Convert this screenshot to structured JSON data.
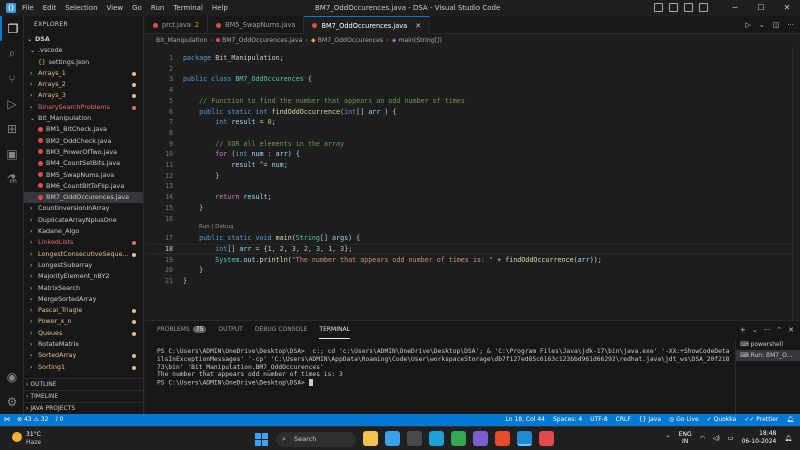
{
  "titlebar": {
    "menu": [
      "File",
      "Edit",
      "Selection",
      "View",
      "Go",
      "Run",
      "Terminal",
      "Help"
    ],
    "title": "BM7_OddOccurences.java - DSA - Visual Studio Code"
  },
  "sidebar": {
    "header": "EXPLORER",
    "root": "DSA",
    "rows": [
      {
        "label": ".vscode",
        "kind": "folder-open",
        "indent": 1,
        "color": "#cccccc"
      },
      {
        "label": "settings.json",
        "kind": "json",
        "indent": 2,
        "color": "#cccccc"
      },
      {
        "label": "Arrays_1",
        "kind": "folder",
        "indent": 1,
        "color": "#e2c08d",
        "dot": "#e2c08d"
      },
      {
        "label": "Arrays_2",
        "kind": "folder",
        "indent": 1,
        "color": "#e2c08d",
        "dot": "#e2c08d"
      },
      {
        "label": "Arrays_3",
        "kind": "folder",
        "indent": 1,
        "color": "#e2c08d",
        "dot": "#e2c08d"
      },
      {
        "label": "BinarySearchProblems",
        "kind": "folder",
        "indent": 1,
        "color": "#e06c6c",
        "dot": "#e06c6c"
      },
      {
        "label": "Bit_Manipulation",
        "kind": "folder-open",
        "indent": 1,
        "color": "#cccccc"
      },
      {
        "label": "BM1_BitCheck.java",
        "kind": "java",
        "indent": 2,
        "color": "#cccccc"
      },
      {
        "label": "BM2_OddCheck.java",
        "kind": "java",
        "indent": 2,
        "color": "#cccccc"
      },
      {
        "label": "BM3_PowerOfTwo.java",
        "kind": "java",
        "indent": 2,
        "color": "#cccccc"
      },
      {
        "label": "BM4_CountSetBits.java",
        "kind": "java",
        "indent": 2,
        "color": "#cccccc"
      },
      {
        "label": "BM5_SwapNums.java",
        "kind": "java",
        "indent": 2,
        "color": "#cccccc"
      },
      {
        "label": "BM6_CountBitToFlip.java",
        "kind": "java",
        "indent": 2,
        "color": "#cccccc"
      },
      {
        "label": "BM7_OddOccurences.java",
        "kind": "java",
        "indent": 2,
        "color": "#cccccc",
        "selected": true
      },
      {
        "label": "CountInversionInArray",
        "kind": "folder",
        "indent": 1,
        "color": "#cccccc"
      },
      {
        "label": "DuplicateArrayNplusOne",
        "kind": "folder",
        "indent": 1,
        "color": "#cccccc"
      },
      {
        "label": "Kadane_Algo",
        "kind": "folder",
        "indent": 1,
        "color": "#cccccc"
      },
      {
        "label": "LinkedLists",
        "kind": "folder",
        "indent": 1,
        "color": "#e06c6c",
        "dot": "#e06c6c"
      },
      {
        "label": "LongestConsecutiveSeque...",
        "kind": "folder",
        "indent": 1,
        "color": "#e2c08d",
        "dot": "#e2c08d"
      },
      {
        "label": "LongestSubarray",
        "kind": "folder",
        "indent": 1,
        "color": "#cccccc"
      },
      {
        "label": "MajorityElement_nBY2",
        "kind": "folder",
        "indent": 1,
        "color": "#cccccc"
      },
      {
        "label": "MatrixSearch",
        "kind": "folder",
        "indent": 1,
        "color": "#cccccc"
      },
      {
        "label": "MergeSortedArray",
        "kind": "folder",
        "indent": 1,
        "color": "#cccccc"
      },
      {
        "label": "Pascal_Triagle",
        "kind": "folder",
        "indent": 1,
        "color": "#e2c08d",
        "dot": "#e2c08d"
      },
      {
        "label": "Power_x_n",
        "kind": "folder",
        "indent": 1,
        "color": "#e2c08d",
        "dot": "#e2c08d"
      },
      {
        "label": "Queues",
        "kind": "folder",
        "indent": 1,
        "color": "#e2c08d",
        "dot": "#e2c08d"
      },
      {
        "label": "RotateMatrix",
        "kind": "folder",
        "indent": 1,
        "color": "#cccccc"
      },
      {
        "label": "SortedArray",
        "kind": "folder",
        "indent": 1,
        "color": "#e2c08d",
        "dot": "#e2c08d"
      },
      {
        "label": "Sorting1",
        "kind": "folder",
        "indent": 1,
        "color": "#e2c08d",
        "dot": "#e2c08d"
      }
    ],
    "sections": [
      "OUTLINE",
      "TIMELINE",
      "JAVA PROJECTS"
    ]
  },
  "tabs": [
    {
      "label": "prct.java",
      "badge": "2",
      "active": false
    },
    {
      "label": "BM5_SwapNums.java",
      "badge": "",
      "active": false
    },
    {
      "label": "BM7_OddOccurences.java",
      "badge": "",
      "active": true
    }
  ],
  "breadcrumb": [
    "Bit_Manipulation",
    "BM7_OddOccurences.java",
    "BM7_OddOccurences",
    "main(String[])"
  ],
  "editor": {
    "current_line": 18,
    "lines": [
      {
        "n": "1",
        "tokens": [
          [
            "kw",
            "package "
          ],
          [
            "",
            "Bit_Manipulation;"
          ]
        ]
      },
      {
        "n": "2",
        "tokens": []
      },
      {
        "n": "3",
        "tokens": [
          [
            "kw",
            "public class "
          ],
          [
            "ty",
            "BM7_OddOccurences"
          ],
          [
            "",
            " {"
          ]
        ]
      },
      {
        "n": "4",
        "tokens": []
      },
      {
        "n": "5",
        "tokens": [
          [
            "",
            "    "
          ],
          [
            "cm",
            "// Function to find the number that appears an odd number of times"
          ]
        ]
      },
      {
        "n": "6",
        "tokens": [
          [
            "",
            "    "
          ],
          [
            "kw",
            "public static int "
          ],
          [
            "fn",
            "findOddOccurrence"
          ],
          [
            "",
            "("
          ],
          [
            "kw",
            "int"
          ],
          [
            "",
            "[] "
          ],
          [
            "vr",
            "arr"
          ],
          [
            "",
            " ) {"
          ]
        ]
      },
      {
        "n": "7",
        "tokens": [
          [
            "",
            "        "
          ],
          [
            "kw",
            "int "
          ],
          [
            "vr",
            "result"
          ],
          [
            "",
            " = "
          ],
          [
            "nm",
            "0"
          ],
          [
            "",
            ";"
          ]
        ]
      },
      {
        "n": "8",
        "tokens": []
      },
      {
        "n": "9",
        "tokens": [
          [
            "",
            "        "
          ],
          [
            "cm",
            "// XOR all elements in the array"
          ]
        ]
      },
      {
        "n": "10",
        "tokens": [
          [
            "",
            "        "
          ],
          [
            "ctl",
            "for"
          ],
          [
            "",
            " ("
          ],
          [
            "kw",
            "int "
          ],
          [
            "vr",
            "num"
          ],
          [
            "",
            " : "
          ],
          [
            "vr",
            "arr"
          ],
          [
            "",
            ") {"
          ]
        ]
      },
      {
        "n": "11",
        "tokens": [
          [
            "",
            "            "
          ],
          [
            "vr",
            "result"
          ],
          [
            "",
            " ^= "
          ],
          [
            "vr",
            "num"
          ],
          [
            "",
            ";"
          ]
        ]
      },
      {
        "n": "12",
        "tokens": [
          [
            "",
            "        }"
          ]
        ]
      },
      {
        "n": "13",
        "tokens": []
      },
      {
        "n": "14",
        "tokens": [
          [
            "",
            "        "
          ],
          [
            "ctl",
            "return "
          ],
          [
            "vr",
            "result"
          ],
          [
            "",
            ";"
          ]
        ]
      },
      {
        "n": "15",
        "tokens": [
          [
            "",
            "    }"
          ]
        ]
      },
      {
        "n": "16",
        "tokens": []
      },
      {
        "n": "17",
        "tokens": [
          [
            "",
            "    "
          ],
          [
            "kw",
            "public static void "
          ],
          [
            "fn",
            "main"
          ],
          [
            "",
            "("
          ],
          [
            "ty",
            "String"
          ],
          [
            "",
            "[] "
          ],
          [
            "vr",
            "args"
          ],
          [
            "",
            ") {"
          ]
        ]
      },
      {
        "n": "18",
        "tokens": [
          [
            "",
            "        "
          ],
          [
            "kw",
            "int"
          ],
          [
            "",
            "[] "
          ],
          [
            "vr",
            "arr"
          ],
          [
            "",
            " = {"
          ],
          [
            "nm",
            "1"
          ],
          [
            "",
            ", "
          ],
          [
            "nm",
            "2"
          ],
          [
            "",
            ", "
          ],
          [
            "nm",
            "3"
          ],
          [
            "",
            ", "
          ],
          [
            "nm",
            "2"
          ],
          [
            "",
            ", "
          ],
          [
            "nm",
            "3"
          ],
          [
            "",
            ", "
          ],
          [
            "nm",
            "1"
          ],
          [
            "",
            ", "
          ],
          [
            "nm",
            "3"
          ],
          [
            "",
            "};"
          ]
        ]
      },
      {
        "n": "19",
        "tokens": [
          [
            "",
            "        "
          ],
          [
            "ty",
            "System"
          ],
          [
            "",
            "."
          ],
          [
            "vr",
            "out"
          ],
          [
            "",
            "."
          ],
          [
            "fn",
            "println"
          ],
          [
            "",
            "("
          ],
          [
            "str",
            "\"The number that appears odd number of times is: \""
          ],
          [
            "",
            " + "
          ],
          [
            "fn",
            "findOddOccurrence"
          ],
          [
            "",
            "("
          ],
          [
            "vr",
            "arr"
          ],
          [
            "",
            "));"
          ]
        ]
      },
      {
        "n": "20",
        "tokens": [
          [
            "",
            "    }"
          ]
        ]
      },
      {
        "n": "21",
        "tokens": [
          [
            "",
            "}"
          ]
        ]
      }
    ],
    "codelens": "Run | Debug"
  },
  "panel": {
    "tabs": [
      {
        "label": "PROBLEMS",
        "count": "75"
      },
      {
        "label": "OUTPUT",
        "count": ""
      },
      {
        "label": "DEBUG CONSOLE",
        "count": ""
      },
      {
        "label": "TERMINAL",
        "count": "",
        "active": true
      }
    ],
    "terminal_lines": [
      "PS C:\\Users\\ADMIN\\OneDrive\\Desktop\\DSA>  c:; cd 'c:\\Users\\ADMIN\\OneDrive\\Desktop\\DSA'; & 'C:\\Program Files\\Java\\jdk-17\\bin\\java.exe' '-XX:+ShowCodeDeta",
      "ilsInExceptionMessages' '-cp' 'C:\\Users\\ADMIN\\AppData\\Roaming\\Code\\User\\workspaceStorage\\db7f127ed85c6163c123bbd961d66292\\redhat.java\\jdt_ws\\DSA_20f218",
      "73\\bin' 'Bit_Manipulation.BM7_OddOccurences'",
      "The number that appears odd number of times is: 3",
      "PS C:\\Users\\ADMIN\\OneDrive\\Desktop\\DSA> "
    ],
    "terminals": [
      "powershell",
      "Run: BM7_O..."
    ]
  },
  "statusbar": {
    "errors": "43",
    "warnings": "32",
    "position": "Ln 18, Col 44",
    "spaces": "Spaces: 4",
    "encoding": "UTF-8",
    "eol": "CRLF",
    "language": "Java",
    "golive": "Go Live",
    "quokka": "Quokka",
    "prettier": "Prettier"
  },
  "taskbar": {
    "weather_temp": "31°C",
    "weather_desc": "Haze",
    "search_placeholder": "Search",
    "lang_top": "ENG",
    "lang_bottom": "IN",
    "time": "18:48",
    "date": "06-10-2024",
    "apps": [
      {
        "name": "file-explorer-app-icon",
        "color": "#f2c14e"
      },
      {
        "name": "photos-app-icon",
        "color": "#3aa0e8"
      },
      {
        "name": "terminal-app-icon",
        "color": "#4b4b4b"
      },
      {
        "name": "edge-app-icon",
        "color": "#1aa1d8"
      },
      {
        "name": "chrome-app-icon",
        "color": "#34a853"
      },
      {
        "name": "media-app-icon",
        "color": "#7a5fd0"
      },
      {
        "name": "mail-app-icon",
        "color": "#e84a2a"
      },
      {
        "name": "vscode-app-icon",
        "color": "#1f8ad2",
        "active": true
      },
      {
        "name": "chrome-profile-app-icon",
        "color": "#e34a4a"
      }
    ]
  },
  "colors": {
    "accent": "#0078d4",
    "statusbar": "#0078d4"
  }
}
